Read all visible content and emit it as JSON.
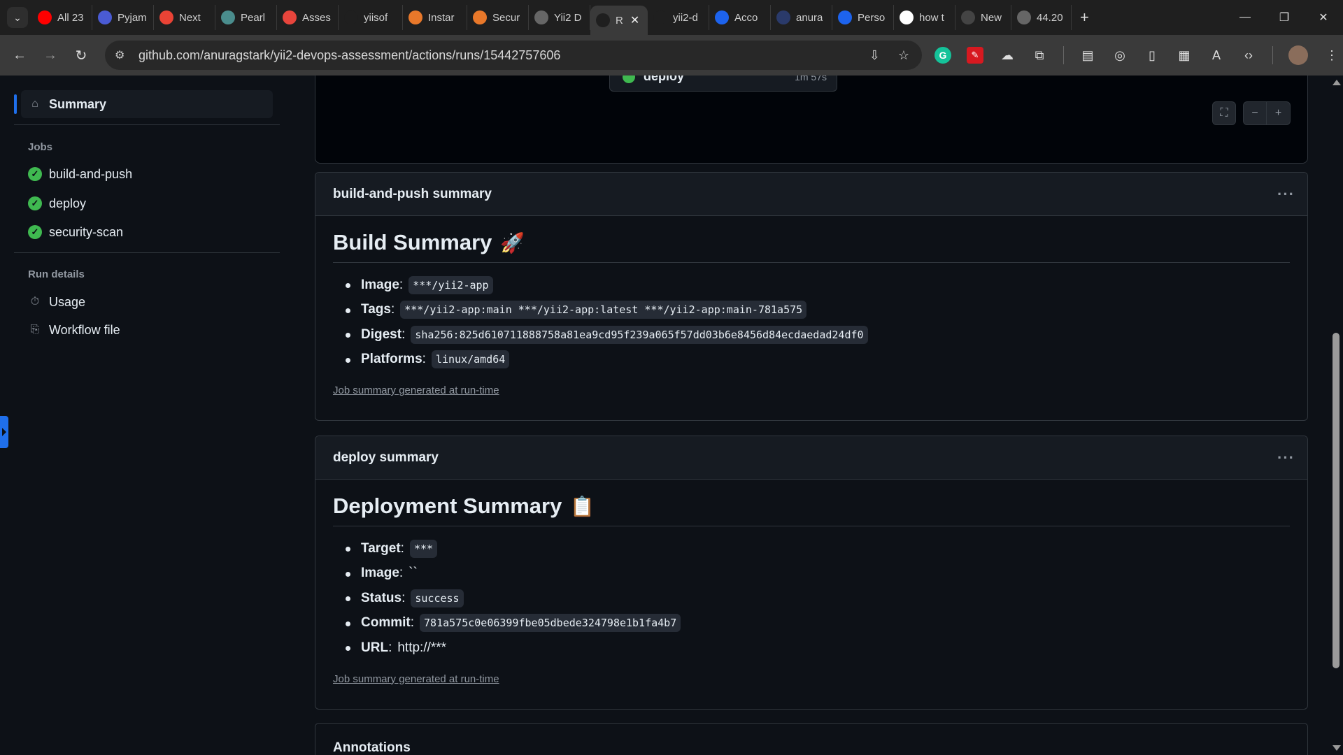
{
  "browser": {
    "tabs": [
      {
        "label": "All 23",
        "icon": "youtube-icon",
        "color": "#ff0000"
      },
      {
        "label": "Pyjam",
        "icon": "pyjama-icon",
        "color": "#4a5bd4"
      },
      {
        "label": "Next",
        "icon": "gmail-icon",
        "color": "#ea4335"
      },
      {
        "label": "Pearl",
        "icon": "globe-icon",
        "color": "#4a8d8d"
      },
      {
        "label": "Asses",
        "icon": "app-icon",
        "color": "#e8453c"
      },
      {
        "label": "yiisof",
        "icon": "github-icon",
        "color": "#1f1f1f"
      },
      {
        "label": "Instar",
        "icon": "aws-icon",
        "color": "#e8782a"
      },
      {
        "label": "Secur",
        "icon": "aws-icon",
        "color": "#e8782a"
      },
      {
        "label": "Yii2 D",
        "icon": "globe-icon",
        "color": "#666"
      },
      {
        "label": "R",
        "icon": "github-actions-icon",
        "color": "#1f1f1f",
        "active": true
      },
      {
        "label": "yii2-d",
        "icon": "github-icon",
        "color": "#1f1f1f"
      },
      {
        "label": "Acco",
        "icon": "docker-icon",
        "color": "#1d63ed"
      },
      {
        "label": "anura",
        "icon": "docker-icon",
        "color": "#2a3a6a"
      },
      {
        "label": "Perso",
        "icon": "docker-icon",
        "color": "#1d63ed"
      },
      {
        "label": "how t",
        "icon": "google-icon",
        "color": "#fff"
      },
      {
        "label": "New",
        "icon": "chrome-icon",
        "color": "#444"
      },
      {
        "label": "44.20",
        "icon": "globe-icon",
        "color": "#666"
      }
    ],
    "url_host": "github.com",
    "url_path": "/anuragstark/yii2-devops-assessment/actions/runs/15442757606"
  },
  "sidebar": {
    "summary_label": "Summary",
    "jobs_heading": "Jobs",
    "jobs": [
      {
        "label": "build-and-push"
      },
      {
        "label": "deploy"
      },
      {
        "label": "security-scan"
      }
    ],
    "run_details_heading": "Run details",
    "run_details": [
      {
        "label": "Usage"
      },
      {
        "label": "Workflow file"
      }
    ]
  },
  "graph": {
    "node_label": "deploy",
    "node_time": "1m 57s"
  },
  "build_summary": {
    "header": "build-and-push summary",
    "title": "Build Summary",
    "emoji": "🚀",
    "items": [
      {
        "key": "Image",
        "value": "***/yii2-app",
        "code": true
      },
      {
        "key": "Tags",
        "value": "***/yii2-app:main ***/yii2-app:latest ***/yii2-app:main-781a575",
        "code": true
      },
      {
        "key": "Digest",
        "value": "sha256:825d610711888758a81ea9cd95f239a065f57dd03b6e8456d84ecdaedad24df0",
        "code": true
      },
      {
        "key": "Platforms",
        "value": "linux/amd64",
        "code": true
      }
    ],
    "footer": "Job summary generated at run-time"
  },
  "deploy_summary": {
    "header": "deploy summary",
    "title": "Deployment Summary",
    "emoji": "📋",
    "items": [
      {
        "key": "Target",
        "value": "***",
        "code": true
      },
      {
        "key": "Image",
        "value": "``",
        "code": false
      },
      {
        "key": "Status",
        "value": "success",
        "code": true
      },
      {
        "key": "Commit",
        "value": "781a575c0e06399fbe05dbede324798e1b1fa4b7",
        "code": true
      },
      {
        "key": "URL",
        "value": "http://***",
        "code": false
      }
    ],
    "footer": "Job summary generated at run-time"
  },
  "annotations": {
    "header": "Annotations"
  },
  "colors": {
    "accent": "#1f6feb",
    "success": "#3fb950",
    "background": "#0d1117"
  }
}
